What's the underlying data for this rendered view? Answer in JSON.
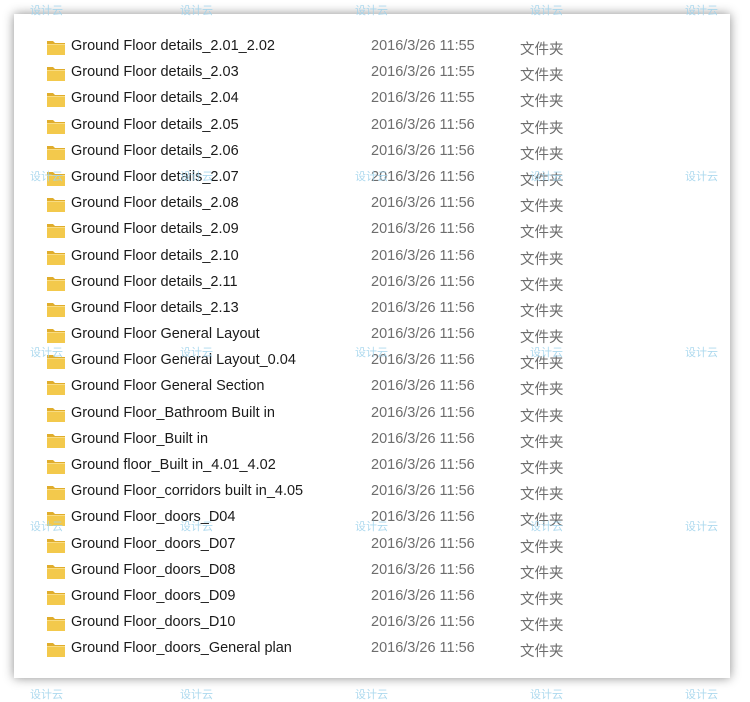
{
  "watermark": "设计云",
  "type_label": "文件夹",
  "files": [
    {
      "name": "Ground Floor details_2.01_2.02",
      "date": "2016/3/26 11:55"
    },
    {
      "name": "Ground Floor details_2.03",
      "date": "2016/3/26 11:55"
    },
    {
      "name": "Ground Floor details_2.04",
      "date": "2016/3/26 11:55"
    },
    {
      "name": "Ground Floor details_2.05",
      "date": "2016/3/26 11:56"
    },
    {
      "name": "Ground Floor details_2.06",
      "date": "2016/3/26 11:56"
    },
    {
      "name": "Ground Floor details_2.07",
      "date": "2016/3/26 11:56"
    },
    {
      "name": "Ground Floor details_2.08",
      "date": "2016/3/26 11:56"
    },
    {
      "name": "Ground Floor details_2.09",
      "date": "2016/3/26 11:56"
    },
    {
      "name": "Ground Floor details_2.10",
      "date": "2016/3/26 11:56"
    },
    {
      "name": "Ground Floor details_2.11",
      "date": "2016/3/26 11:56"
    },
    {
      "name": "Ground Floor details_2.13",
      "date": "2016/3/26 11:56"
    },
    {
      "name": "Ground Floor General Layout",
      "date": "2016/3/26 11:56"
    },
    {
      "name": "Ground Floor General Layout_0.04",
      "date": "2016/3/26 11:56"
    },
    {
      "name": "Ground Floor General Section",
      "date": "2016/3/26 11:56"
    },
    {
      "name": "Ground Floor_Bathroom Built in",
      "date": "2016/3/26 11:56"
    },
    {
      "name": "Ground Floor_Built in",
      "date": "2016/3/26 11:56"
    },
    {
      "name": "Ground floor_Built in_4.01_4.02",
      "date": "2016/3/26 11:56"
    },
    {
      "name": "Ground Floor_corridors built in_4.05",
      "date": "2016/3/26 11:56"
    },
    {
      "name": "Ground Floor_doors_D04",
      "date": "2016/3/26 11:56"
    },
    {
      "name": "Ground Floor_doors_D07",
      "date": "2016/3/26 11:56"
    },
    {
      "name": "Ground Floor_doors_D08",
      "date": "2016/3/26 11:56"
    },
    {
      "name": "Ground Floor_doors_D09",
      "date": "2016/3/26 11:56"
    },
    {
      "name": "Ground Floor_doors_D10",
      "date": "2016/3/26 11:56"
    },
    {
      "name": "Ground Floor_doors_General plan",
      "date": "2016/3/26 11:56"
    }
  ],
  "colors": {
    "folder_body": "#f3c94c",
    "folder_tab": "#e0ad2c",
    "watermark": "#9fd3ec"
  },
  "icons": {
    "folder": "folder-icon"
  }
}
